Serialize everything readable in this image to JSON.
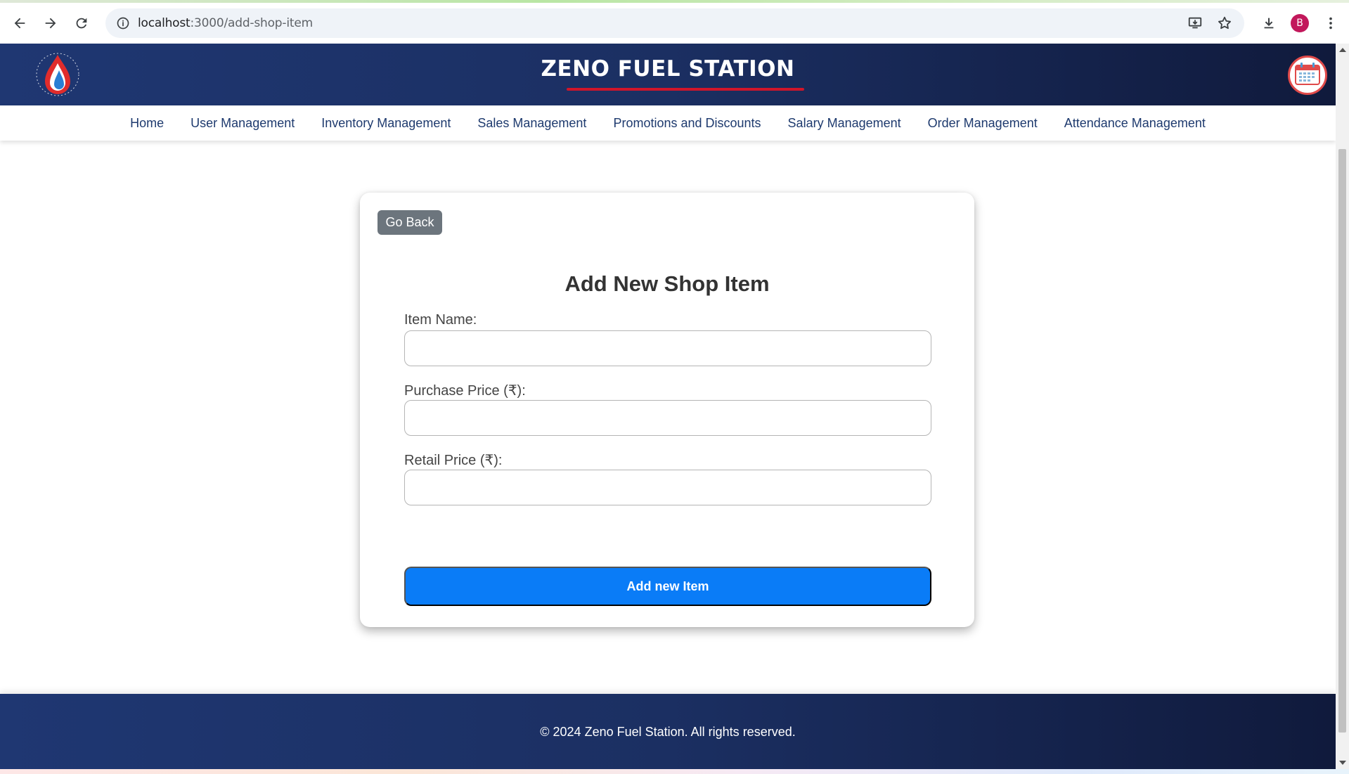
{
  "browser": {
    "url_host": "localhost",
    "url_path": ":3000/add-shop-item",
    "profile_initial": "B"
  },
  "header": {
    "site_title": "ZENO FUEL STATION"
  },
  "nav": {
    "items": [
      {
        "label": "Home"
      },
      {
        "label": "User Management"
      },
      {
        "label": "Inventory Management"
      },
      {
        "label": "Sales Management"
      },
      {
        "label": "Promotions and Discounts"
      },
      {
        "label": "Salary Management"
      },
      {
        "label": "Order Management"
      },
      {
        "label": "Attendance Management"
      }
    ]
  },
  "form": {
    "go_back_label": "Go Back",
    "title": "Add New Shop Item",
    "fields": [
      {
        "label": "Item Name:",
        "value": ""
      },
      {
        "label": "Purchase Price (₹):",
        "value": ""
      },
      {
        "label": "Retail Price (₹):",
        "value": ""
      }
    ],
    "submit_label": "Add new Item"
  },
  "footer": {
    "text": "© 2024 Zeno Fuel Station. All rights reserved."
  },
  "colors": {
    "header_bg": "#1b2f62",
    "accent_red": "#d0152a",
    "primary_button": "#0a7cf7",
    "secondary_button": "#6c757d",
    "nav_text": "#1e3a6e"
  }
}
